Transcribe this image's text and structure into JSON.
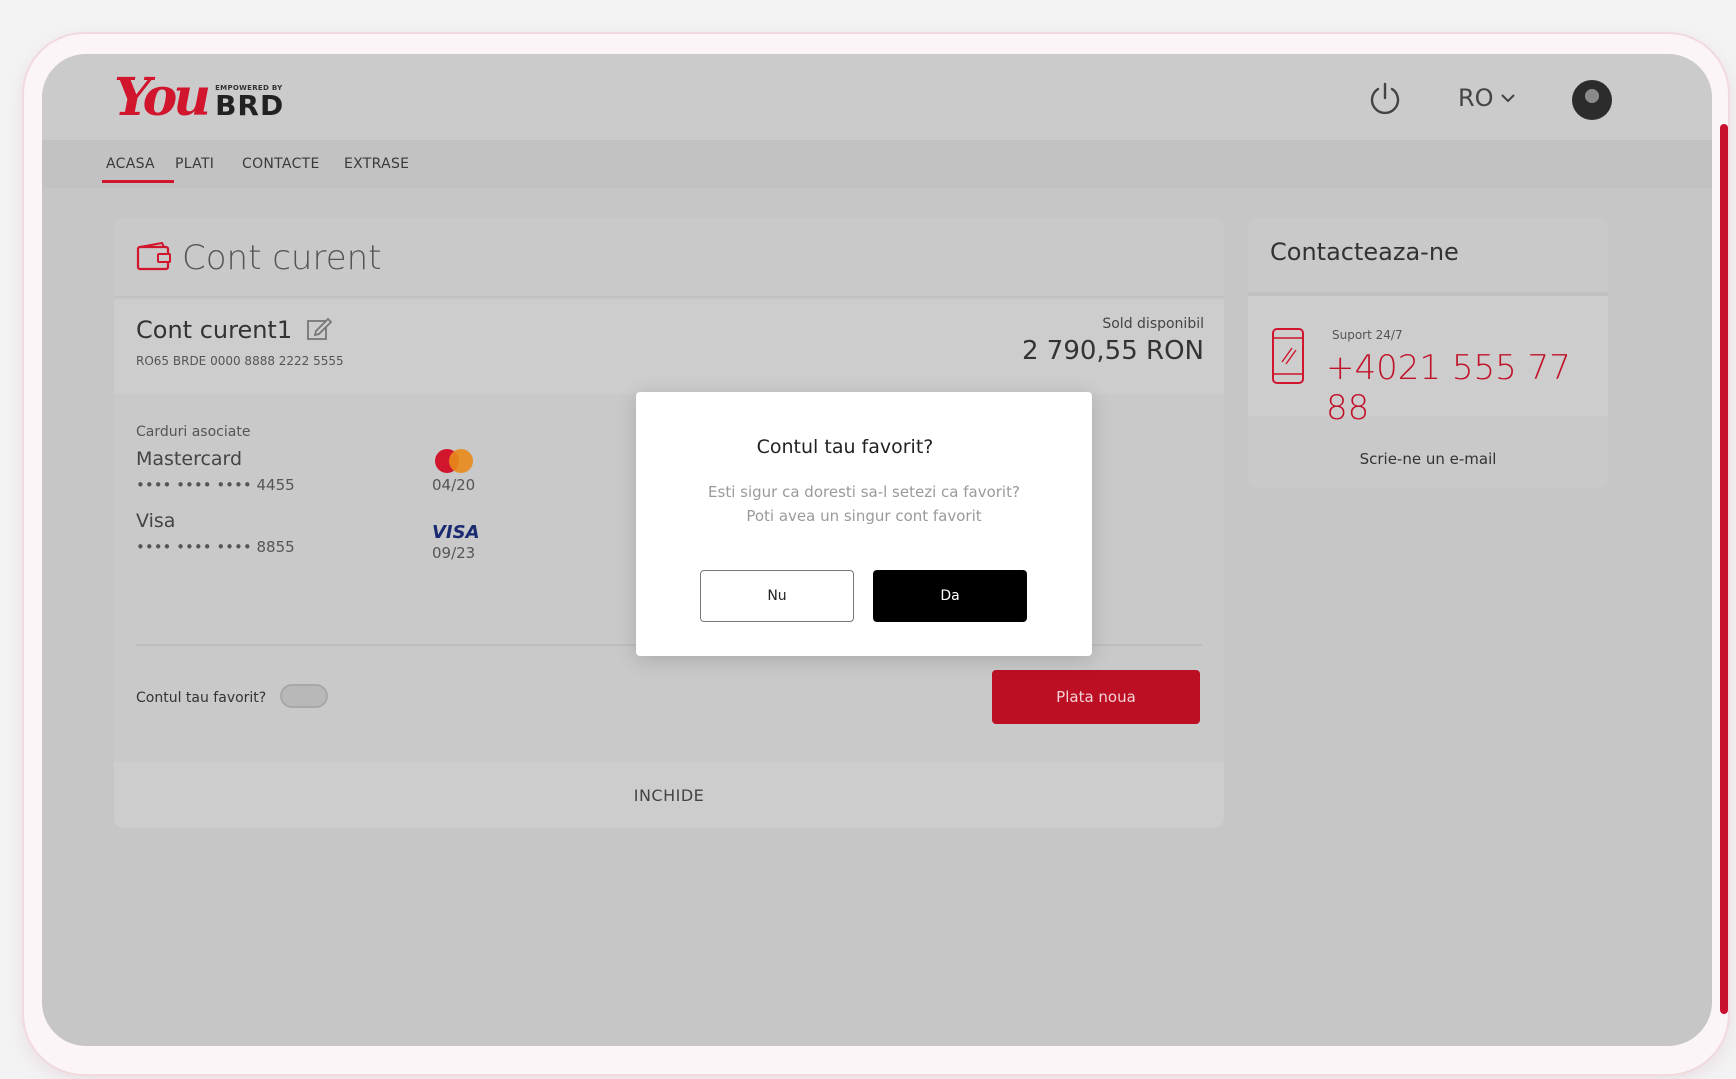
{
  "header": {
    "logo_you": "You",
    "logo_small": "EMPOWERED BY",
    "logo_brd": "BRD",
    "language": "RO"
  },
  "nav": {
    "items": [
      "ACASA",
      "PLATI",
      "CONTACTE",
      "EXTRASE"
    ],
    "active": "ACASA"
  },
  "account_card": {
    "title": "Cont curent",
    "account_name": "Cont curent1",
    "iban": "RO65 BRDE 0000 8888 2222 5555",
    "balance_label": "Sold disponibil",
    "balance_value": "2 790,55 RON",
    "cards_label": "Carduri asociate",
    "cards": [
      {
        "name": "Mastercard",
        "number": "•••• •••• •••• 4455",
        "expiry": "04/20",
        "brand": "mastercard-logo"
      },
      {
        "name": "Visa",
        "number": "•••• •••• ••••  8855",
        "expiry": "09/23",
        "brand_text": "VISA"
      }
    ],
    "favorite_label": "Contul tau favorit?",
    "favorite_on": false,
    "new_payment": "Plata noua",
    "close": "INCHIDE"
  },
  "contact": {
    "title": "Contacteaza-ne",
    "support_label": "Suport 24/7",
    "phone": "+4021 555 77 88",
    "email_link": "Scrie-ne un e-mail"
  },
  "modal": {
    "title": "Contul tau favorit?",
    "line1": "Esti sigur ca doresti sa-l setezi ca favorit?",
    "line2": "Poti avea un singur cont favorit",
    "no": "Nu",
    "yes": "Da"
  },
  "colors": {
    "brand_red": "#c8102e",
    "overlay_gray": "#c6c6c6",
    "modal_bg": "#ffffff",
    "confirm_black": "#000000"
  }
}
